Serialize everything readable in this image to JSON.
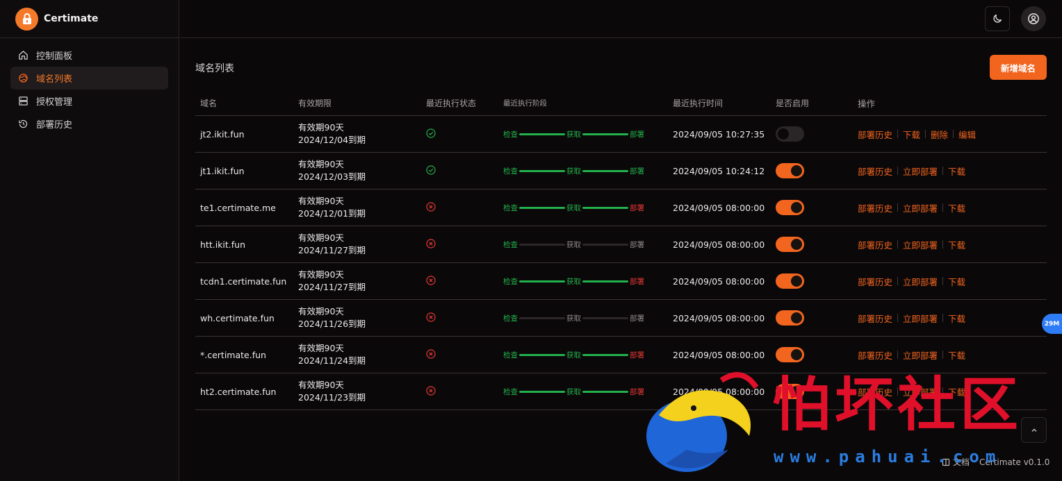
{
  "app": {
    "name": "Certimate",
    "accent": "#f2651f"
  },
  "sidebar": {
    "items": [
      {
        "label": "控制面板",
        "icon": "home-icon",
        "active": false
      },
      {
        "label": "域名列表",
        "icon": "globe-icon",
        "active": true
      },
      {
        "label": "授权管理",
        "icon": "server-icon",
        "active": false
      },
      {
        "label": "部署历史",
        "icon": "history-icon",
        "active": false
      }
    ]
  },
  "header": {
    "theme_icon": "moon-icon",
    "user_icon": "user-circle-icon"
  },
  "main": {
    "title": "域名列表",
    "add_button": "新增域名"
  },
  "table": {
    "columns": [
      "域名",
      "有效期限",
      "最近执行状态",
      "最近执行阶段",
      "最近执行时间",
      "是否启用",
      "操作"
    ],
    "stage_labels": [
      "检查",
      "获取",
      "部署"
    ],
    "rows": [
      {
        "domain": "jt2.ikit.fun",
        "valid_days": "有效期90天",
        "expiry": "2024/12/04到期",
        "status": "success",
        "stages": [
          "success",
          "success",
          "success"
        ],
        "time": "2024/09/05 10:27:35",
        "enabled": false,
        "ops": [
          "部署历史",
          "下载",
          "删除",
          "编辑"
        ]
      },
      {
        "domain": "jt1.ikit.fun",
        "valid_days": "有效期90天",
        "expiry": "2024/12/03到期",
        "status": "success",
        "stages": [
          "success",
          "success",
          "success"
        ],
        "time": "2024/09/05 10:24:12",
        "enabled": true,
        "ops": [
          "部署历史",
          "立即部署",
          "下载"
        ]
      },
      {
        "domain": "te1.certimate.me",
        "valid_days": "有效期90天",
        "expiry": "2024/12/01到期",
        "status": "fail",
        "stages": [
          "success",
          "success",
          "fail"
        ],
        "time": "2024/09/05 08:00:00",
        "enabled": true,
        "ops": [
          "部署历史",
          "立即部署",
          "下载"
        ]
      },
      {
        "domain": "htt.ikit.fun",
        "valid_days": "有效期90天",
        "expiry": "2024/11/27到期",
        "status": "fail",
        "stages": [
          "success",
          "none",
          "none"
        ],
        "time": "2024/09/05 08:00:00",
        "enabled": true,
        "ops": [
          "部署历史",
          "立即部署",
          "下载"
        ]
      },
      {
        "domain": "tcdn1.certimate.fun",
        "valid_days": "有效期90天",
        "expiry": "2024/11/27到期",
        "status": "fail",
        "stages": [
          "success",
          "success",
          "fail"
        ],
        "time": "2024/09/05 08:00:00",
        "enabled": true,
        "ops": [
          "部署历史",
          "立即部署",
          "下载"
        ]
      },
      {
        "domain": "wh.certimate.fun",
        "valid_days": "有效期90天",
        "expiry": "2024/11/26到期",
        "status": "fail",
        "stages": [
          "success",
          "none",
          "none"
        ],
        "time": "2024/09/05 08:00:00",
        "enabled": true,
        "ops": [
          "部署历史",
          "立即部署",
          "下载"
        ]
      },
      {
        "domain": "*.certimate.fun",
        "valid_days": "有效期90天",
        "expiry": "2024/11/24到期",
        "status": "fail",
        "stages": [
          "success",
          "success",
          "fail"
        ],
        "time": "2024/09/05 08:00:00",
        "enabled": true,
        "ops": [
          "部署历史",
          "立即部署",
          "下载"
        ]
      },
      {
        "domain": "ht2.certimate.fun",
        "valid_days": "有效期90天",
        "expiry": "2024/11/23到期",
        "status": "fail",
        "stages": [
          "success",
          "success",
          "fail"
        ],
        "time": "2024/09/05 08:00:00",
        "enabled": true,
        "ops": [
          "部署历史",
          "立即部署",
          "下载"
        ]
      }
    ]
  },
  "float_badge": "29M",
  "footer": {
    "docs": "文档",
    "version": "Certimate v0.1.0"
  },
  "watermark": {
    "text": "怕坏社区",
    "url": "www.pahuai.com"
  },
  "colors": {
    "success": "#22b14c",
    "fail": "#e53935",
    "pending": "#8f8a8b"
  }
}
